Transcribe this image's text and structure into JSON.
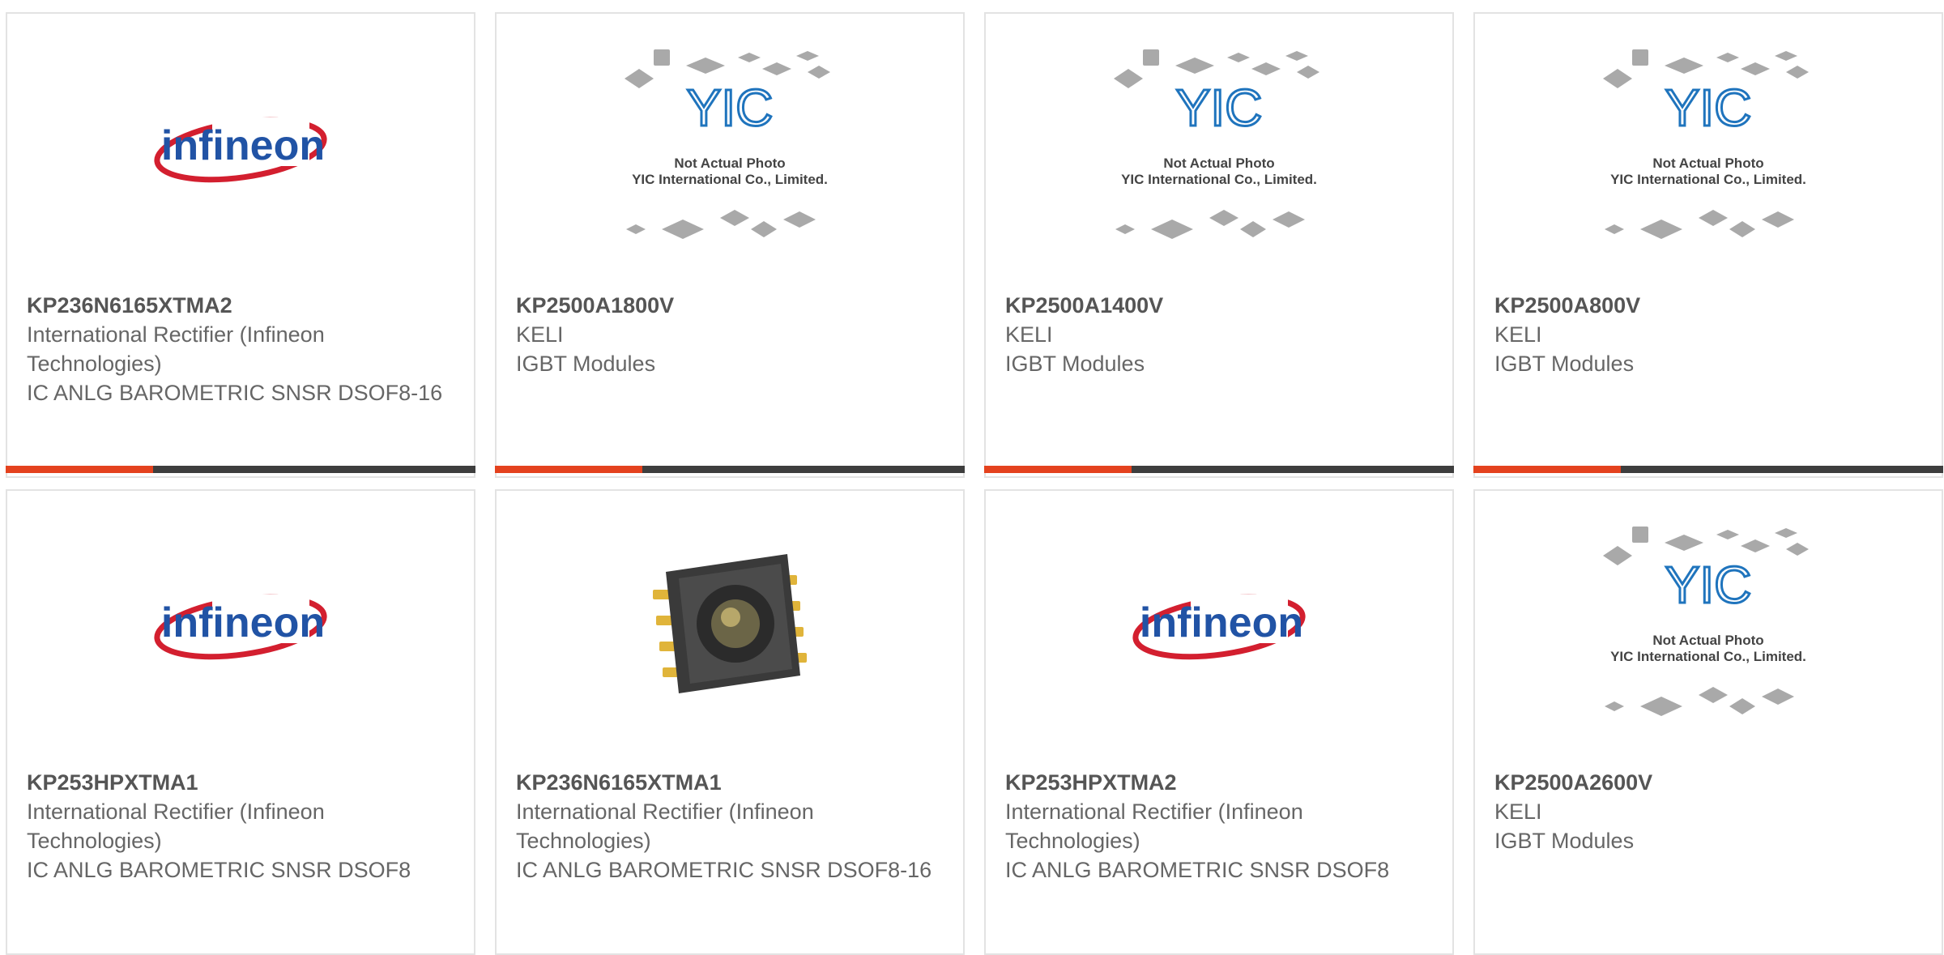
{
  "placeholder": {
    "logo_text": "YIC",
    "line1": "Not Actual Photo",
    "line2": "YIC International Co., Limited."
  },
  "brand_logo_text": "infineon",
  "colors": {
    "accent": "#e4421e",
    "bar": "#3e3e3e",
    "infineon_red": "#d31f2f",
    "infineon_blue": "#2153a5",
    "yic_blue": "#1f74bd"
  },
  "products": [
    {
      "part": "KP236N6165XTMA2",
      "maker": "International Rectifier (Infineon Technologies)",
      "desc": "IC ANLG BAROMETRIC SNSR DSOF8-16",
      "image": "infineon-logo",
      "has_bar": true
    },
    {
      "part": "KP2500A1800V",
      "maker": "KELI",
      "desc": "IGBT Modules",
      "image": "placeholder-photo",
      "has_bar": true
    },
    {
      "part": "KP2500A1400V",
      "maker": "KELI",
      "desc": "IGBT Modules",
      "image": "placeholder-photo",
      "has_bar": true
    },
    {
      "part": "KP2500A800V",
      "maker": "KELI",
      "desc": "IGBT Modules",
      "image": "placeholder-photo",
      "has_bar": true
    },
    {
      "part": "KP253HPXTMA1",
      "maker": "International Rectifier (Infineon Technologies)",
      "desc": "IC ANLG BAROMETRIC SNSR DSOF8",
      "image": "infineon-logo",
      "has_bar": false
    },
    {
      "part": "KP236N6165XTMA1",
      "maker": "International Rectifier (Infineon Technologies)",
      "desc": "IC ANLG BAROMETRIC SNSR DSOF8-16",
      "image": "sensor-chip-photo",
      "has_bar": false
    },
    {
      "part": "KP253HPXTMA2",
      "maker": "International Rectifier (Infineon Technologies)",
      "desc": "IC ANLG BAROMETRIC SNSR DSOF8",
      "image": "infineon-logo",
      "has_bar": false
    },
    {
      "part": "KP2500A2600V",
      "maker": "KELI",
      "desc": "IGBT Modules",
      "image": "placeholder-photo",
      "has_bar": false
    }
  ]
}
